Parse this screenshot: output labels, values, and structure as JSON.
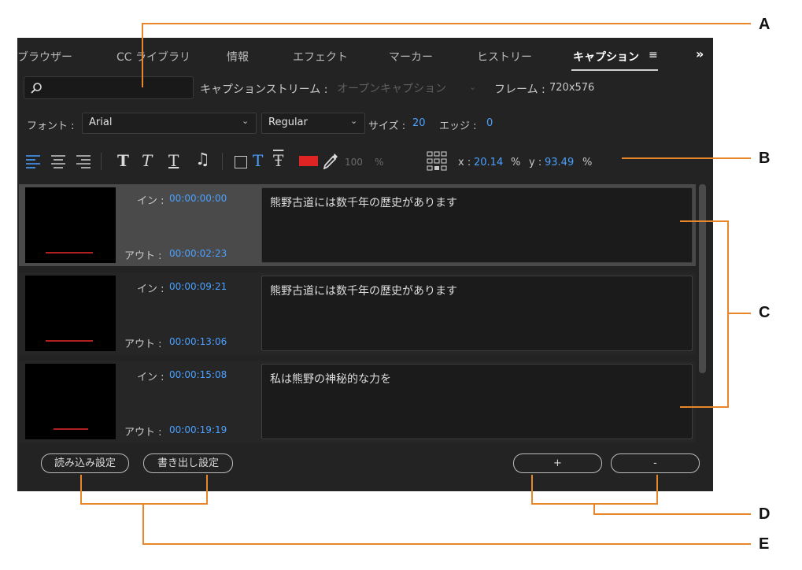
{
  "tabs": [
    "ブラウザー",
    "CC ライブラリ",
    "情報",
    "エフェクト",
    "マーカー",
    "ヒストリー",
    "キャプション"
  ],
  "tab_menu_icon": "≡",
  "overflow_icon": "»",
  "search": {
    "placeholder": ""
  },
  "stream": {
    "label": "キャプションストリーム :",
    "value": "オープンキャプション",
    "frame_label": "フレーム :",
    "frame_value": "720x576"
  },
  "font": {
    "label": "フォント :",
    "family": "Arial",
    "style": "Regular",
    "size_label": "サイズ :",
    "size": "20",
    "edge_label": "エッジ :",
    "edge": "0"
  },
  "toolbar": {
    "opacity": "100",
    "percent": "%",
    "x_label": "x :",
    "x_value": "20.14",
    "y_label": "y :",
    "y_value": "93.49",
    "color": "#e02424"
  },
  "captions": [
    {
      "in_label": "イン :",
      "in": "00:00:00:00",
      "out_label": "アウト :",
      "out": "00:00:02:23",
      "text": "熊野古道には数千年の歴史があります",
      "selected": true
    },
    {
      "in_label": "イン :",
      "in": "00:00:09:21",
      "out_label": "アウト :",
      "out": "00:00:13:06",
      "text": "熊野古道には数千年の歴史があります",
      "selected": false
    },
    {
      "in_label": "イン :",
      "in": "00:00:15:08",
      "out_label": "アウト :",
      "out": "00:00:19:19",
      "text": "私は熊野の神秘的な力を",
      "selected": false
    }
  ],
  "buttons": {
    "import": "読み込み設定",
    "export": "書き出し設定",
    "add": "+",
    "remove": "-"
  },
  "callouts": {
    "a": "A",
    "b": "B",
    "c": "C",
    "d": "D",
    "e": "E"
  },
  "colors": {
    "accent": "#4aa0ff",
    "callout": "#e8872a"
  }
}
